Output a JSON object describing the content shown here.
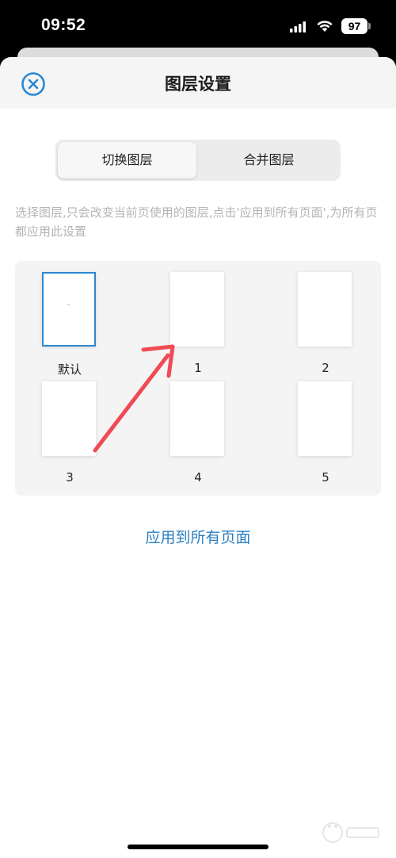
{
  "status_bar": {
    "time": "09:52",
    "battery": "97",
    "icons": [
      "signal-icon",
      "wifi-icon",
      "battery-icon"
    ]
  },
  "header": {
    "title": "图层设置",
    "close_icon": "close-circle-icon"
  },
  "tabs": [
    {
      "label": "切换图层",
      "active": true
    },
    {
      "label": "合并图层",
      "active": false
    }
  ],
  "description": "选择图层,只会改变当前页使用的图层,点击'应用到所有页面',为所有页都应用此设置",
  "layers": [
    {
      "label": "默认",
      "selected": true
    },
    {
      "label": "1",
      "selected": false
    },
    {
      "label": "2",
      "selected": false
    },
    {
      "label": "3",
      "selected": false
    },
    {
      "label": "4",
      "selected": false
    },
    {
      "label": "5",
      "selected": false
    }
  ],
  "apply_all_label": "应用到所有页面",
  "colors": {
    "accent": "#2b87d1",
    "link": "#2b7fc0",
    "annotation_arrow": "#ef4b55"
  }
}
